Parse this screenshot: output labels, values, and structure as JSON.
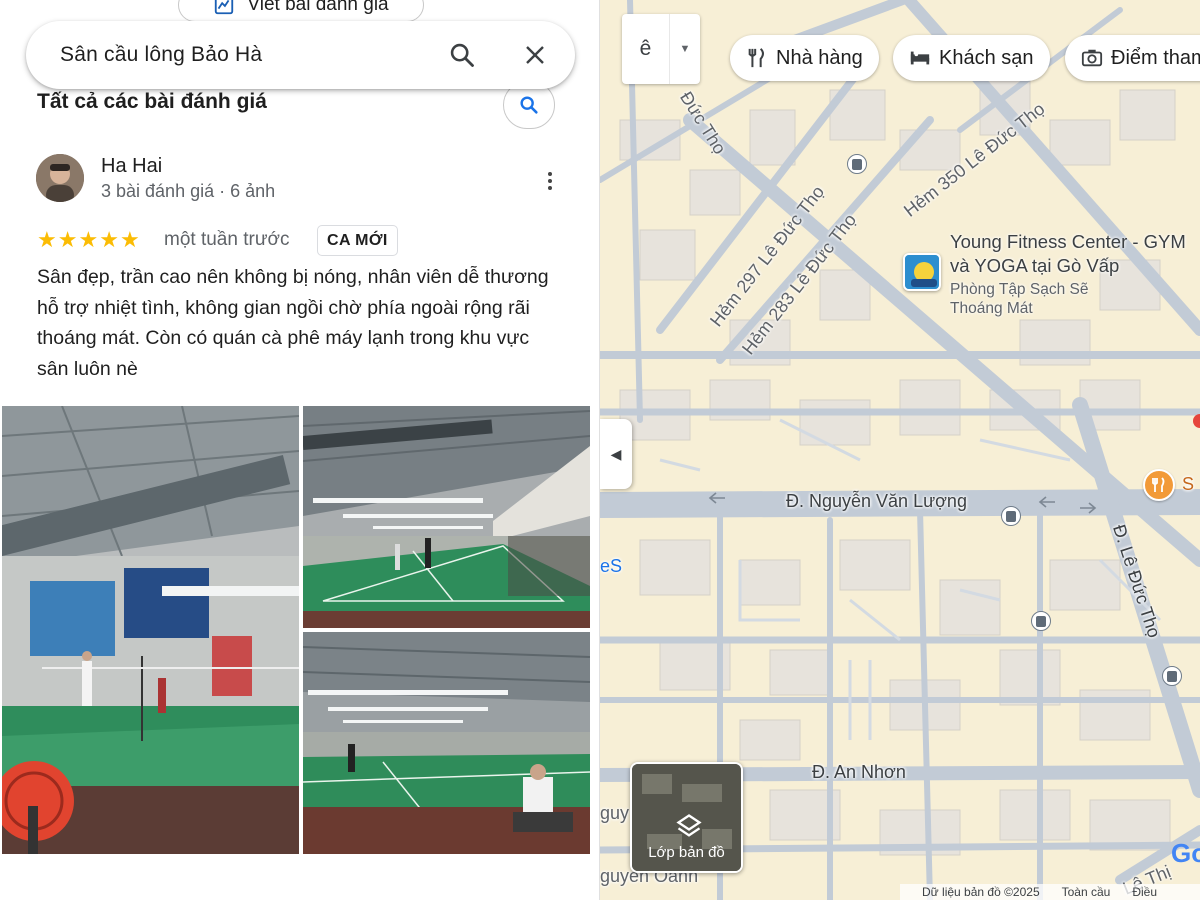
{
  "panel": {
    "write_review_label": "Viết bài đánh giá",
    "search_query": "Sân cầu lông Bảo Hà",
    "section_title": "Tất cả các bài đánh giá",
    "review": {
      "author": "Ha Hai",
      "meta": "3 bài đánh giá · 6 ảnh",
      "rating": 5,
      "stars": "★★★★★",
      "time": "một tuần trước",
      "badge": "CA MỚI",
      "text": "Sân đẹp, trần cao nên không bị nóng, nhân viên dễ thương hỗ trợ nhiệt tình, không gian ngồi chờ phía ngoài rộng rãi thoáng mát. Còn có quán cà phê máy lạnh trong khu vực sân luôn nè"
    }
  },
  "map": {
    "language_label": "ê",
    "chips": [
      {
        "label": "Nhà hàng",
        "icon": "fork-knife-icon"
      },
      {
        "label": "Khách sạn",
        "icon": "bed-icon"
      },
      {
        "label": "Điểm tham",
        "icon": "camera-icon"
      }
    ],
    "streets": {
      "duc_tho_top": "Đức Thọ",
      "hem350": "Hẻm 350 Lê Đức Thọ",
      "hem297": "Hẻm 297 Lê Đức Thọ",
      "hem283": "Hẻm 283 Lê Đức Thọ",
      "nguyen_van_luong": "Đ. Nguyễn Văn Lượng",
      "le_duc_tho": "Đ. Lê Đức Thọ",
      "an_nhon": "Đ. An Nhơn",
      "le_thi": "Lê Thị",
      "guy": "guy",
      "guyen_oanh": "guyen Oanh",
      "es": "eS"
    },
    "poi": {
      "name": "Young Fitness Center - GYM và YOGA tại Gò Vấp",
      "subtitle": "Phòng Tập Sạch Sẽ Thoáng Mát"
    },
    "food_partial": "S",
    "layers_label": "Lớp bản đồ",
    "footer": {
      "data": "Dữ liệu bản đồ ©2025",
      "global": "Toàn cầu",
      "terms": "Điều"
    },
    "google_partial": "Go"
  }
}
